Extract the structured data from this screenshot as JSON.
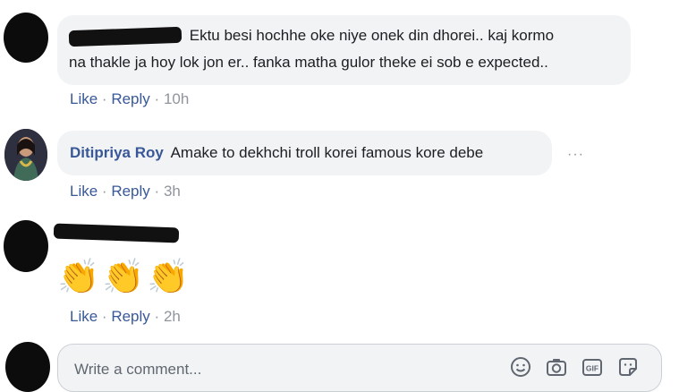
{
  "comments": [
    {
      "text_line1": "Ektu besi hochhe oke niye onek din dhorei.. kaj kormo",
      "text_line2": "na thakle ja hoy lok jon er.. fanka matha gulor theke ei sob e expected..",
      "like": "Like",
      "reply": "Reply",
      "sep": "·",
      "time": "10h"
    },
    {
      "author": "Ditipriya Roy",
      "text": "Amake to dekhchi troll korei famous kore debe",
      "like": "Like",
      "reply": "Reply",
      "sep": "·",
      "time": "3h",
      "more": "···"
    },
    {
      "emoji": [
        "👏",
        "👏",
        "👏"
      ],
      "like": "Like",
      "reply": "Reply",
      "sep": "·",
      "time": "2h"
    }
  ],
  "composer": {
    "placeholder": "Write a comment..."
  },
  "icons": {
    "composer": [
      "emoji-icon",
      "camera-icon",
      "gif-icon",
      "sticker-icon"
    ]
  },
  "colors": {
    "link": "#385898",
    "bubble": "#f2f3f5",
    "meta": "#90949c"
  }
}
